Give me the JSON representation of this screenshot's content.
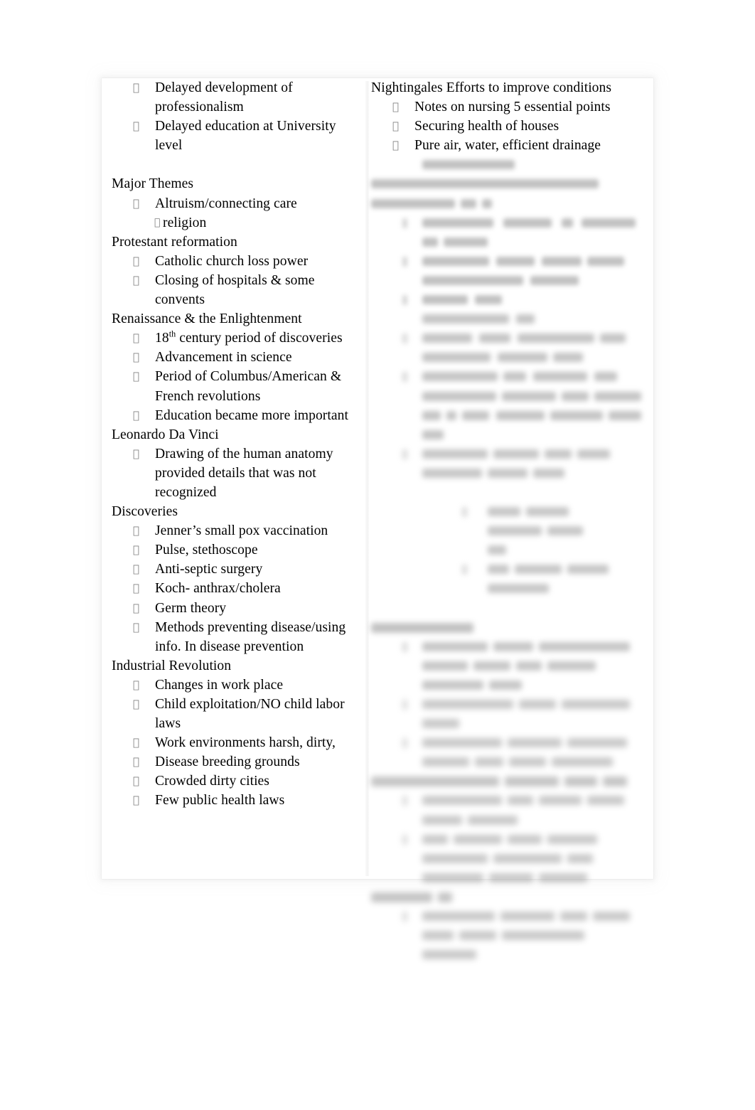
{
  "document": {
    "type": "study-notes",
    "page_background": "#ffffff",
    "text_color": "#000000",
    "bullet_glyph": "",
    "sub_bullet_glyph": "",
    "columns": 2
  },
  "left_column": {
    "blocks": [
      {
        "kind": "bullet",
        "text": "Delayed development of professionalism"
      },
      {
        "kind": "bullet",
        "text": "Delayed education at University level"
      },
      {
        "kind": "spacer"
      },
      {
        "kind": "heading",
        "text": "Major Themes"
      },
      {
        "kind": "bullet",
        "text": "Altruism/connecting care"
      },
      {
        "kind": "sub-bullet",
        "text": "religion"
      },
      {
        "kind": "heading",
        "text": "Protestant reformation"
      },
      {
        "kind": "bullet",
        "text": "Catholic church loss power"
      },
      {
        "kind": "bullet",
        "text": "Closing of hospitals & some convents"
      },
      {
        "kind": "heading",
        "text": "Renaissance & the Enlightenment"
      },
      {
        "kind": "bullet",
        "text_pre": "18",
        "superscript": "th",
        "text_post": " century period of discoveries"
      },
      {
        "kind": "bullet",
        "text": "Advancement in science"
      },
      {
        "kind": "bullet",
        "text": "Period of Columbus/American & French revolutions"
      },
      {
        "kind": "bullet",
        "text": "Education became more important"
      },
      {
        "kind": "heading",
        "text": "Leonardo Da Vinci"
      },
      {
        "kind": "bullet",
        "text": "Drawing of the human anatomy provided details that was not recognized"
      },
      {
        "kind": "heading",
        "text": "Discoveries"
      },
      {
        "kind": "bullet",
        "text": "Jenner’s small pox vaccination"
      },
      {
        "kind": "bullet",
        "text": "Pulse, stethoscope"
      },
      {
        "kind": "bullet",
        "text": "Anti-septic surgery"
      },
      {
        "kind": "bullet",
        "text": "Koch- anthrax/cholera"
      },
      {
        "kind": "bullet",
        "text": "Germ theory"
      },
      {
        "kind": "bullet",
        "text": "Methods preventing disease/using info. In disease prevention"
      },
      {
        "kind": "heading",
        "text": "Industrial Revolution"
      },
      {
        "kind": "bullet",
        "text": "Changes in work place"
      },
      {
        "kind": "bullet",
        "text": "Child exploitation/NO child labor laws"
      },
      {
        "kind": "bullet",
        "text": "Work environments harsh, dirty,"
      },
      {
        "kind": "bullet",
        "text": "Disease breeding grounds"
      },
      {
        "kind": "bullet",
        "text": "Crowded dirty cities"
      },
      {
        "kind": "bullet",
        "text": "Few public health laws"
      }
    ]
  },
  "right_column": {
    "legible_blocks": [
      {
        "kind": "heading",
        "text": "Nightingales Efforts to improve conditions"
      },
      {
        "kind": "bullet",
        "text": "Notes on nursing 5 essential points"
      },
      {
        "kind": "bullet",
        "text": "Securing health of houses"
      },
      {
        "kind": "bullet",
        "text": "Pure air, water, efficient drainage"
      }
    ],
    "illegible_note": "remaining right-column text is blurred beyond legibility",
    "redacted_lines": [
      {
        "blur": "a",
        "bullet": null,
        "segments": [
          [
            72,
            130
          ]
        ]
      },
      {
        "blur": "a",
        "bullet": null,
        "segments": [
          [
            0,
            320
          ]
        ]
      },
      {
        "blur": "a",
        "bullet": null,
        "segments": [
          [
            0,
            118
          ],
          [
            126,
            22
          ],
          [
            156,
            14
          ]
        ]
      },
      {
        "blur": "a",
        "bullet": 44,
        "segments": [
          [
            72,
            100
          ],
          [
            186,
            68
          ],
          [
            268,
            16
          ],
          [
            296,
            76
          ]
        ]
      },
      {
        "blur": "a",
        "bullet": null,
        "segments": [
          [
            72,
            22
          ],
          [
            102,
            62
          ]
        ]
      },
      {
        "blur": "a",
        "bullet": 44,
        "segments": [
          [
            72,
            94
          ],
          [
            176,
            54
          ],
          [
            240,
            56
          ],
          [
            304,
            52
          ]
        ]
      },
      {
        "blur": "a",
        "bullet": null,
        "segments": [
          [
            72,
            142
          ],
          [
            224,
            68
          ]
        ]
      },
      {
        "blur": "a",
        "bullet": 44,
        "segments": [
          [
            72,
            64
          ],
          [
            146,
            38
          ]
        ]
      },
      {
        "blur": "b",
        "bullet": null,
        "segments": [
          [
            72,
            122
          ],
          [
            204,
            26
          ]
        ]
      },
      {
        "blur": "b",
        "bullet": 44,
        "segments": [
          [
            72,
            70
          ],
          [
            152,
            44
          ],
          [
            206,
            108
          ],
          [
            322,
            36
          ]
        ]
      },
      {
        "blur": "b",
        "bullet": null,
        "segments": [
          [
            72,
            96
          ],
          [
            178,
            70
          ],
          [
            256,
            42
          ]
        ]
      },
      {
        "blur": "b",
        "bullet": 44,
        "segments": [
          [
            72,
            106
          ],
          [
            186,
            32
          ],
          [
            228,
            76
          ],
          [
            314,
            32
          ]
        ]
      },
      {
        "blur": "b",
        "bullet": null,
        "segments": [
          [
            72,
            104
          ],
          [
            184,
            76
          ],
          [
            268,
            38
          ],
          [
            314,
            66
          ]
        ]
      },
      {
        "blur": "b",
        "bullet": null,
        "segments": [
          [
            72,
            26
          ],
          [
            106,
            14
          ],
          [
            128,
            38
          ],
          [
            176,
            68
          ],
          [
            252,
            74
          ],
          [
            334,
            46
          ]
        ]
      },
      {
        "blur": "b",
        "bullet": null,
        "segments": [
          [
            72,
            30
          ]
        ]
      },
      {
        "blur": "c",
        "bullet": 44,
        "segments": [
          [
            72,
            92
          ],
          [
            172,
            64
          ],
          [
            244,
            38
          ],
          [
            290,
            46
          ]
        ]
      },
      {
        "blur": "c",
        "bullet": null,
        "segments": [
          [
            72,
            84
          ],
          [
            164,
            56
          ],
          [
            228,
            44
          ]
        ]
      },
      {
        "blur": "c",
        "bullet": null,
        "segments": []
      },
      {
        "blur": "c",
        "bullet": 128,
        "segments": [
          [
            164,
            46
          ],
          [
            218,
            60
          ]
        ]
      },
      {
        "blur": "c",
        "bullet": null,
        "segments": [
          [
            164,
            76
          ],
          [
            248,
            50
          ]
        ]
      },
      {
        "blur": "c",
        "bullet": null,
        "segments": [
          [
            164,
            26
          ]
        ]
      },
      {
        "blur": "c",
        "bullet": 128,
        "segments": [
          [
            164,
            30
          ],
          [
            202,
            66
          ],
          [
            276,
            58
          ]
        ]
      },
      {
        "blur": "c",
        "bullet": null,
        "segments": [
          [
            164,
            86
          ]
        ]
      },
      {
        "blur": "c",
        "bullet": null,
        "segments": []
      },
      {
        "blur": "c",
        "bullet": null,
        "head": true,
        "segments": [
          [
            0,
            144
          ]
        ]
      },
      {
        "blur": "c",
        "bullet": 44,
        "segments": [
          [
            72,
            92
          ],
          [
            172,
            56
          ],
          [
            236,
            128
          ]
        ]
      },
      {
        "blur": "c",
        "bullet": null,
        "segments": [
          [
            72,
            64
          ],
          [
            144,
            52
          ],
          [
            204,
            36
          ],
          [
            248,
            68
          ]
        ]
      },
      {
        "blur": "c",
        "bullet": null,
        "segments": [
          [
            72,
            86
          ],
          [
            166,
            46
          ]
        ]
      },
      {
        "blur": "d",
        "bullet": 44,
        "segments": [
          [
            72,
            128
          ],
          [
            208,
            52
          ],
          [
            268,
            96
          ]
        ]
      },
      {
        "blur": "d",
        "bullet": null,
        "segments": [
          [
            72,
            52
          ]
        ]
      },
      {
        "blur": "d",
        "bullet": 44,
        "segments": [
          [
            72,
            112
          ],
          [
            192,
            76
          ],
          [
            276,
            84
          ]
        ]
      },
      {
        "blur": "d",
        "bullet": null,
        "segments": [
          [
            72,
            66
          ],
          [
            146,
            40
          ],
          [
            194,
            52
          ],
          [
            254,
            86
          ]
        ]
      },
      {
        "blur": "d",
        "bullet": null,
        "head": true,
        "segments": [
          [
            0,
            180
          ],
          [
            188,
            76
          ],
          [
            272,
            46
          ],
          [
            326,
            34
          ]
        ]
      },
      {
        "blur": "d",
        "bullet": 44,
        "segments": [
          [
            72,
            112
          ],
          [
            192,
            36
          ],
          [
            236,
            60
          ],
          [
            304,
            52
          ]
        ]
      },
      {
        "blur": "d",
        "bullet": null,
        "segments": [
          [
            72,
            56
          ],
          [
            136,
            70
          ]
        ]
      },
      {
        "blur": "d",
        "bullet": 44,
        "segments": [
          [
            72,
            36
          ],
          [
            116,
            68
          ],
          [
            192,
            48
          ],
          [
            248,
            70
          ]
        ]
      },
      {
        "blur": "d",
        "bullet": null,
        "segments": [
          [
            72,
            92
          ],
          [
            172,
            96
          ],
          [
            276,
            36
          ]
        ]
      },
      {
        "blur": "d",
        "bullet": null,
        "segments": [
          [
            72,
            86
          ],
          [
            166,
            62
          ],
          [
            236,
            68
          ]
        ]
      },
      {
        "blur": "d",
        "bullet": null,
        "head": true,
        "segments": [
          [
            0,
            86
          ],
          [
            94,
            20
          ]
        ]
      },
      {
        "blur": "d",
        "bullet": 44,
        "segments": [
          [
            72,
            102
          ],
          [
            182,
            76
          ],
          [
            266,
            38
          ],
          [
            312,
            52
          ]
        ]
      },
      {
        "blur": "d",
        "bullet": null,
        "segments": [
          [
            72,
            44
          ],
          [
            124,
            52
          ],
          [
            184,
            116
          ]
        ]
      },
      {
        "blur": "d",
        "bullet": null,
        "segments": [
          [
            72,
            76
          ]
        ]
      }
    ]
  }
}
